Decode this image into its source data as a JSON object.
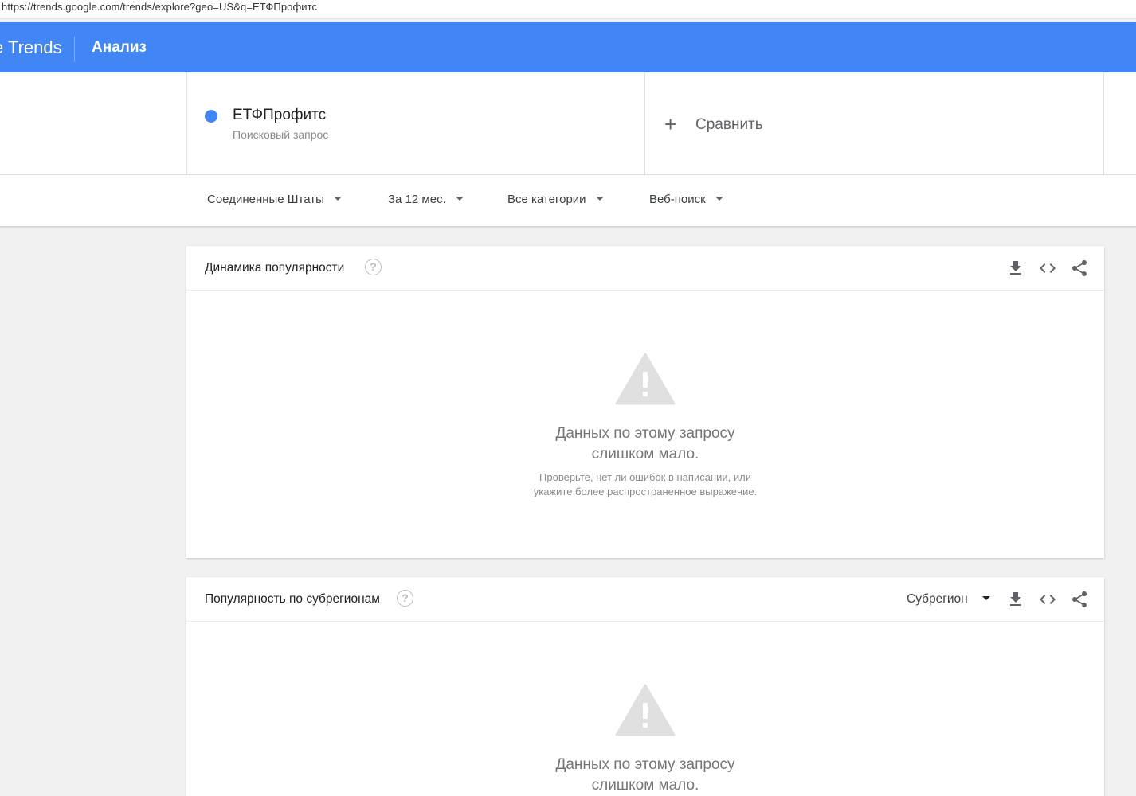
{
  "browser": {
    "url": "https://trends.google.com/trends/explore?geo=US&q=ЕТФПрофитс"
  },
  "appbar": {
    "brand": "e Trends",
    "section": "Анализ"
  },
  "term": {
    "name": "ЕТФПрофитс",
    "type": "Поисковый запрос",
    "color": "#4285f4"
  },
  "compare": {
    "label": "Сравнить"
  },
  "filters": {
    "region": "Соединенные Штаты",
    "period": "За 12 мес.",
    "category": "Все категории",
    "search_type": "Веб-поиск"
  },
  "cards": {
    "interest_over_time": {
      "title": "Динамика популярности",
      "empty_main_line1": "Данных по этому запросу",
      "empty_main_line2": "слишком мало.",
      "empty_sub_line1": "Проверьте, нет ли ошибок в написании, или",
      "empty_sub_line2": "укажите более распространенное выражение."
    },
    "interest_by_subregion": {
      "title": "Популярность по субрегионам",
      "resolution_selected": "Субрегион",
      "empty_main_line1": "Данных по этому запросу",
      "empty_main_line2": "слишком мало."
    }
  },
  "icons": {
    "help": "?",
    "download": "download-icon",
    "embed": "embed-code-icon",
    "share": "share-icon",
    "warning": "warning-icon",
    "plus": "+"
  },
  "colors": {
    "appbar": "#4285f4",
    "page_background": "#f1f1f1"
  }
}
